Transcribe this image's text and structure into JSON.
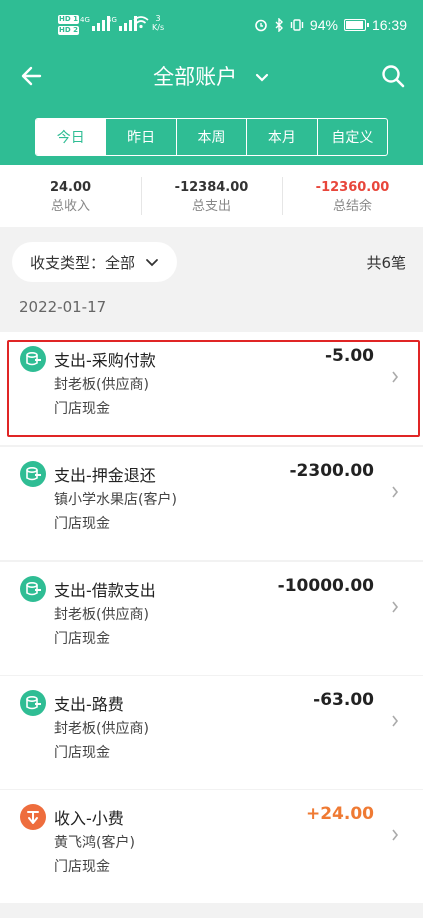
{
  "status_bar": {
    "sim1": "HD 1",
    "sim2": "HD 2",
    "net1": "4G",
    "net2": "4G",
    "speed_value": "3",
    "speed_unit": "K/s",
    "battery_pct": "94%",
    "time": "16:39"
  },
  "header": {
    "back_icon": "arrow-left-icon",
    "title": "全部账户",
    "dropdown_icon": "chevron-down-icon",
    "search_icon": "search-icon",
    "brand_color": "#2fbd94"
  },
  "tabs": [
    {
      "label": "今日",
      "active": true
    },
    {
      "label": "昨日",
      "active": false
    },
    {
      "label": "本周",
      "active": false
    },
    {
      "label": "本月",
      "active": false
    },
    {
      "label": "自定义",
      "active": false
    }
  ],
  "summary": {
    "income": {
      "value": "24.00",
      "label": "总收入"
    },
    "expense": {
      "value": "-12384.00",
      "label": "总支出"
    },
    "balance": {
      "value": "-12360.00",
      "label": "总结余",
      "color": "#e8463b"
    }
  },
  "filter": {
    "label": "收支类型：全部",
    "count": "共6笔"
  },
  "date_group": "2022-01-17",
  "records": [
    {
      "type_icon": "expense-icon",
      "title": "支出-采购付款",
      "amount": "-5.00",
      "party": "封老板(供应商)",
      "account": "门店现金",
      "highlighted": true
    },
    {
      "type_icon": "expense-icon",
      "title": "支出-押金退还",
      "amount": "-2300.00",
      "party": "镇小学水果店(客户)",
      "account": "门店现金"
    },
    {
      "type_icon": "expense-icon",
      "title": "支出-借款支出",
      "amount": "-10000.00",
      "party": "封老板(供应商)",
      "account": "门店现金"
    },
    {
      "type_icon": "expense-icon",
      "title": "支出-路费",
      "amount": "-63.00",
      "party": "封老板(供应商)",
      "account": "门店现金"
    },
    {
      "type_icon": "income-icon",
      "title": "收入-小费",
      "amount": "+24.00",
      "party": "黄飞鸿(客户)",
      "account": "门店现金",
      "amount_color": "#ef7a33"
    }
  ]
}
